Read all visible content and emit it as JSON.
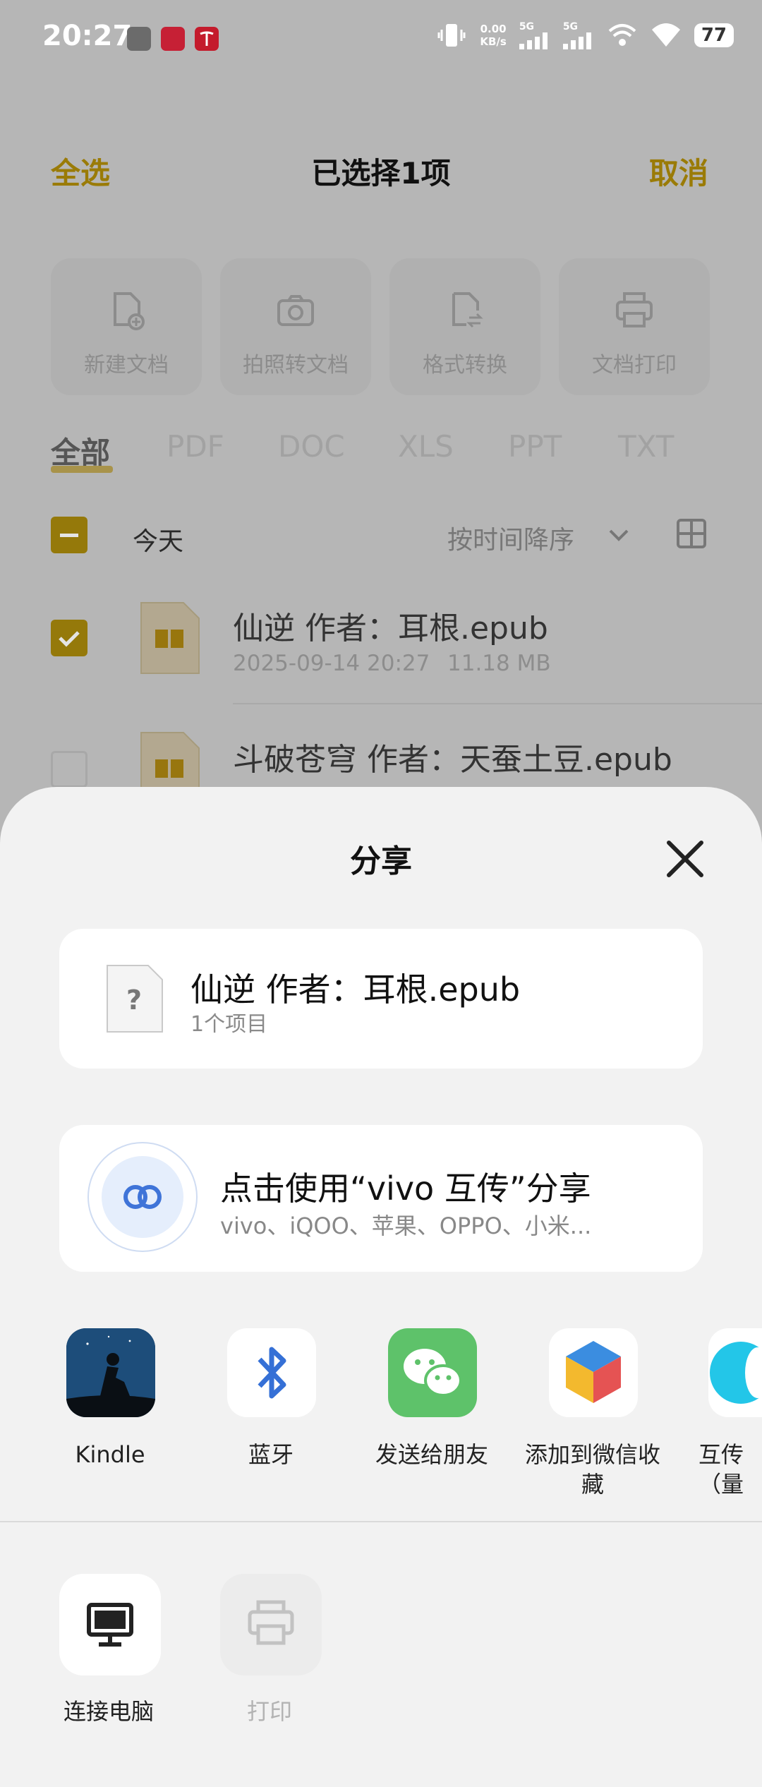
{
  "status_bar": {
    "time": "20:27",
    "app_icons": [
      "阅读",
      "小红书",
      "Tesla"
    ],
    "net_speed_value": "0.00",
    "net_speed_unit": "KB/s",
    "signal_labels": [
      "5G",
      "5G"
    ],
    "battery": "77"
  },
  "header": {
    "select_all": "全选",
    "title": "已选择1项",
    "cancel": "取消"
  },
  "tools": [
    {
      "label": "新建文档",
      "icon": "new-document-icon"
    },
    {
      "label": "拍照转文档",
      "icon": "camera-icon"
    },
    {
      "label": "格式转换",
      "icon": "convert-icon"
    },
    {
      "label": "文档打印",
      "icon": "printer-icon"
    }
  ],
  "filter_tabs": [
    "全部",
    "PDF",
    "DOC",
    "XLS",
    "PPT",
    "TXT"
  ],
  "active_tab": "全部",
  "group": {
    "label": "今天",
    "sort": "按时间降序"
  },
  "files": [
    {
      "name": "仙逆 作者：耳根.epub",
      "date": "2025-09-14 20:27",
      "size": "11.18 MB",
      "checked": true
    },
    {
      "name": "斗破苍穹 作者：天蚕土豆.epub",
      "checked": false
    }
  ],
  "share_sheet": {
    "title": "分享",
    "file_name": "仙逆 作者：耳根.epub",
    "file_sub": "1个项目",
    "vivo_title": "点击使用“vivo 互传”分享",
    "vivo_sub": "vivo、iQOO、苹果、OPPO、小米...",
    "apps": [
      {
        "label": "Kindle",
        "icon": "kindle-icon"
      },
      {
        "label": "蓝牙",
        "icon": "bluetooth-icon"
      },
      {
        "label": "发送给朋友",
        "icon": "wechat-icon"
      },
      {
        "label": "添加到微信收藏",
        "icon": "wechat-favorites-icon"
      },
      {
        "label": "互传（量",
        "icon": "vivo-share-icon"
      }
    ],
    "actions": [
      {
        "label": "连接电脑",
        "icon": "monitor-icon",
        "enabled": true
      },
      {
        "label": "打印",
        "icon": "printer-icon",
        "enabled": false
      }
    ]
  },
  "colors": {
    "accent_dimmed": "#9a7b07",
    "sheet_background": "#f2f2f2",
    "dim_overlay": "#b6b6b6"
  }
}
